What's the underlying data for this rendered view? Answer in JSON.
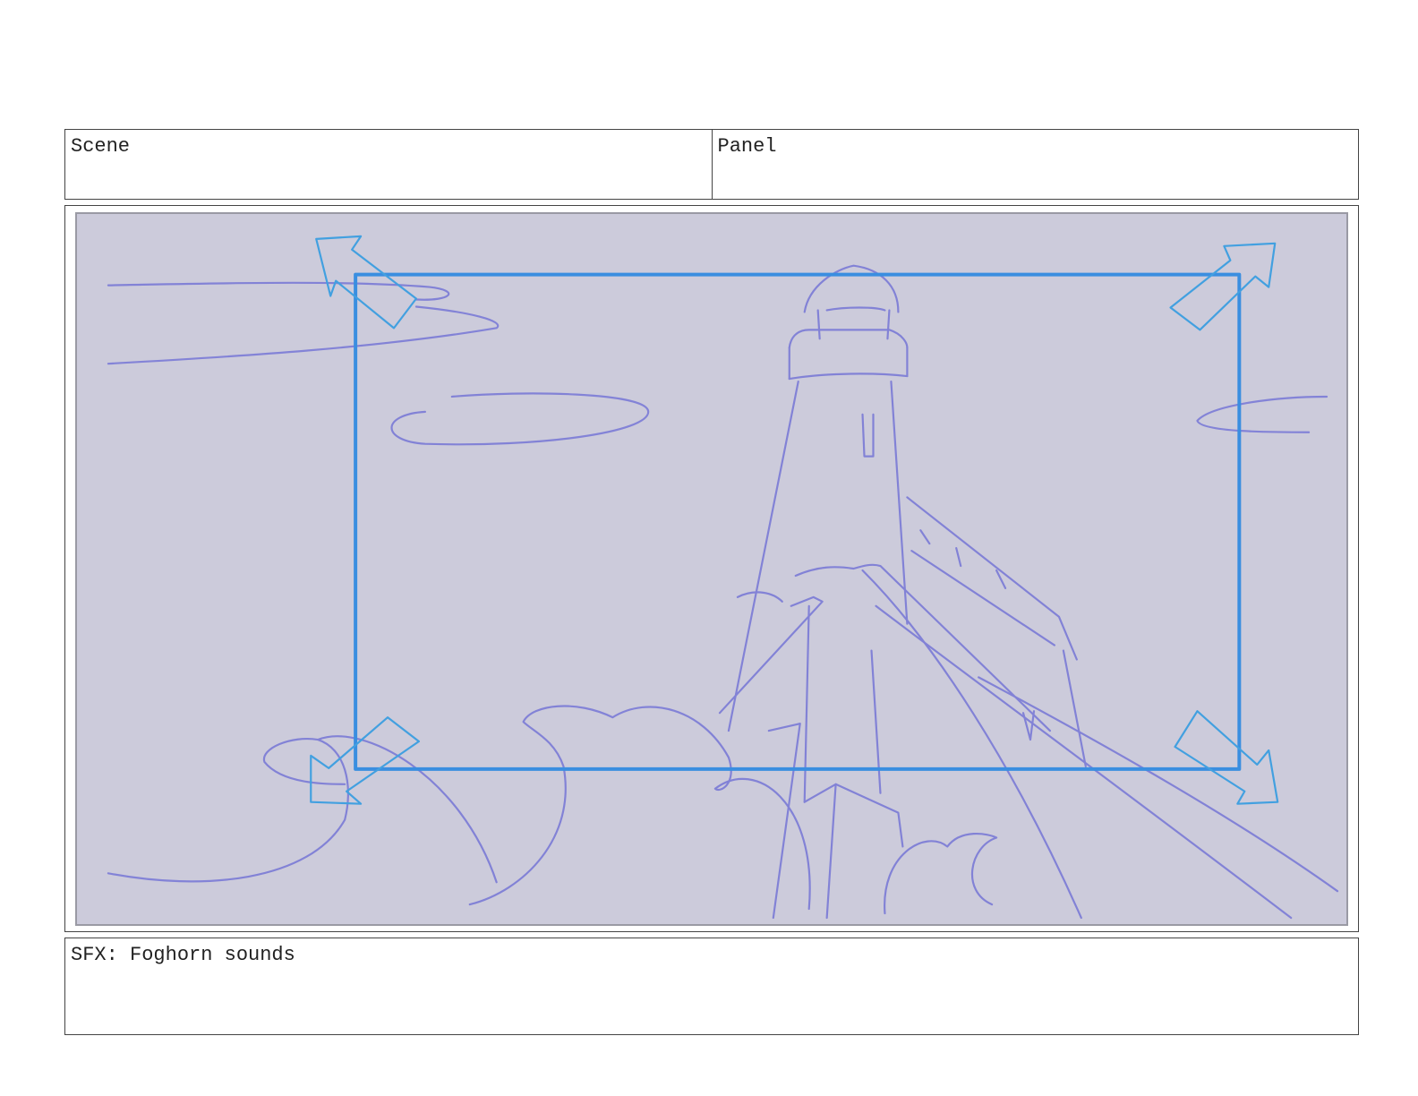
{
  "header": {
    "scene_label": "Scene",
    "panel_label": "Panel"
  },
  "panel_art": {
    "description_icon": "storyboard-sketch",
    "background_color": "#cccbdb",
    "sketch_color": "#7b7bd6",
    "camera_frame_color": "#3a8ee0"
  },
  "notes": {
    "text": "SFX: Foghorn sounds"
  }
}
